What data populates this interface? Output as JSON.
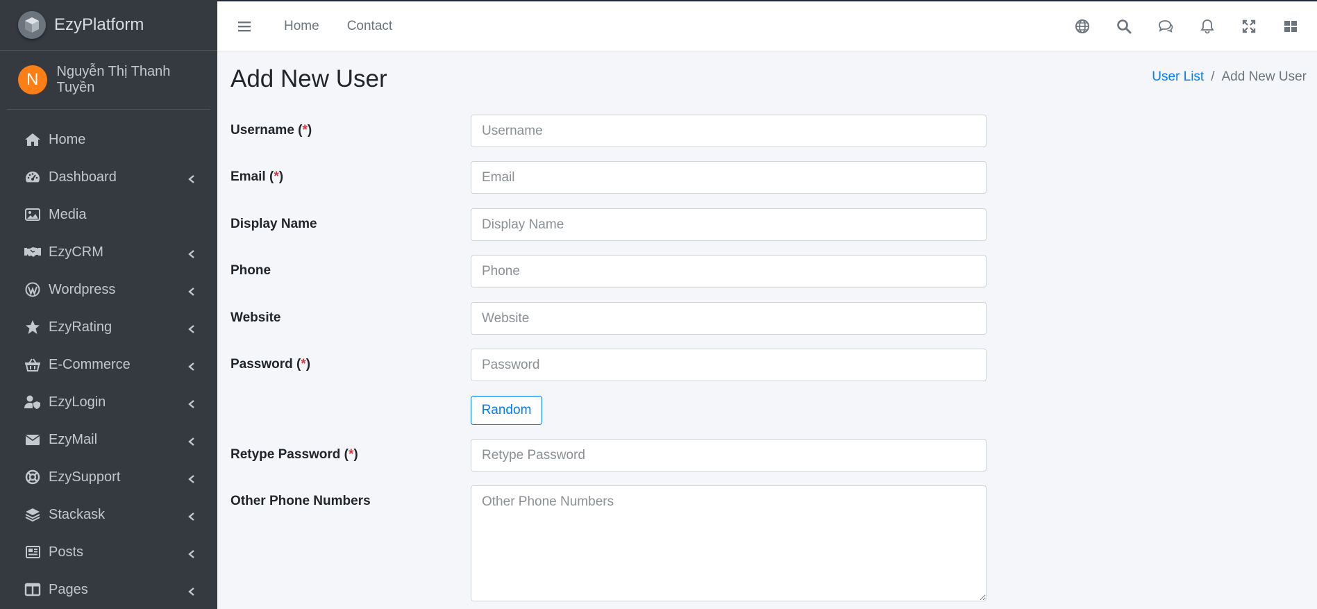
{
  "brand": {
    "name": "EzyPlatform"
  },
  "user": {
    "initial": "N",
    "name": "Nguyễn Thị Thanh Tuyền"
  },
  "sidebar": {
    "items": [
      {
        "label": "Home",
        "icon": "home-icon",
        "has_children": false
      },
      {
        "label": "Dashboard",
        "icon": "gauge-icon",
        "has_children": true
      },
      {
        "label": "Media",
        "icon": "image-icon",
        "has_children": false
      },
      {
        "label": "EzyCRM",
        "icon": "handshake-icon",
        "has_children": true
      },
      {
        "label": "Wordpress",
        "icon": "wordpress-icon",
        "has_children": true
      },
      {
        "label": "EzyRating",
        "icon": "star-icon",
        "has_children": true
      },
      {
        "label": "E-Commerce",
        "icon": "basket-icon",
        "has_children": true
      },
      {
        "label": "EzyLogin",
        "icon": "user-shield-icon",
        "has_children": true
      },
      {
        "label": "EzyMail",
        "icon": "envelope-icon",
        "has_children": true
      },
      {
        "label": "EzySupport",
        "icon": "life-ring-icon",
        "has_children": true
      },
      {
        "label": "Stackask",
        "icon": "layers-icon",
        "has_children": true
      },
      {
        "label": "Posts",
        "icon": "newspaper-icon",
        "has_children": true
      },
      {
        "label": "Pages",
        "icon": "columns-icon",
        "has_children": true
      }
    ]
  },
  "topbar": {
    "links": [
      "Home",
      "Contact"
    ],
    "icons": [
      "globe-icon",
      "search-icon",
      "comments-icon",
      "bell-icon",
      "expand-icon",
      "grid-icon"
    ]
  },
  "page": {
    "title": "Add New User",
    "breadcrumb": {
      "parent": "User List",
      "current": "Add New User"
    }
  },
  "form": {
    "username": {
      "label": "Username",
      "required": "*",
      "placeholder": "Username"
    },
    "email": {
      "label": "Email",
      "required": "*",
      "placeholder": "Email"
    },
    "display_name": {
      "label": "Display Name",
      "placeholder": "Display Name"
    },
    "phone": {
      "label": "Phone",
      "placeholder": "Phone"
    },
    "website": {
      "label": "Website",
      "placeholder": "Website"
    },
    "password": {
      "label": "Password",
      "required": "*",
      "placeholder": "Password"
    },
    "random_button": "Random",
    "retype_password": {
      "label": "Retype Password",
      "required": "*",
      "placeholder": "Retype Password"
    },
    "other_phones": {
      "label": "Other Phone Numbers",
      "placeholder": "Other Phone Numbers"
    }
  },
  "colors": {
    "sidebar_bg": "#343a40",
    "accent": "#007bff",
    "required": "#dc3545",
    "avatar": "#fd7e14"
  }
}
